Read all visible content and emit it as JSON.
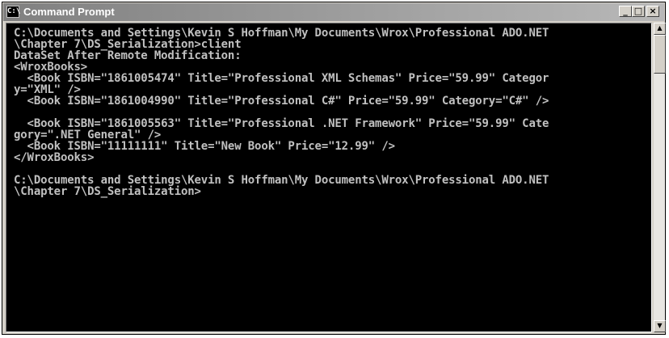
{
  "window": {
    "title": "Command Prompt",
    "icon_label": "C:\\",
    "buttons": {
      "minimize": "_",
      "maximize": "□",
      "close": "×"
    }
  },
  "console": {
    "lines": [
      "C:\\Documents and Settings\\Kevin S Hoffman\\My Documents\\Wrox\\Professional ADO.NET",
      "\\Chapter 7\\DS_Serialization>client",
      "DataSet After Remote Modification:",
      "<WroxBooks>",
      "  <Book ISBN=\"1861005474\" Title=\"Professional XML Schemas\" Price=\"59.99\" Categor",
      "y=\"XML\" />",
      "  <Book ISBN=\"1861004990\" Title=\"Professional C#\" Price=\"59.99\" Category=\"C#\" />",
      "",
      "  <Book ISBN=\"1861005563\" Title=\"Professional .NET Framework\" Price=\"59.99\" Cate",
      "gory=\".NET General\" />",
      "  <Book ISBN=\"11111111\" Title=\"New Book\" Price=\"12.99\" />",
      "</WroxBooks>",
      "",
      "C:\\Documents and Settings\\Kevin S Hoffman\\My Documents\\Wrox\\Professional ADO.NET",
      "\\Chapter 7\\DS_Serialization>"
    ]
  },
  "scrollbar": {
    "up_glyph": "▲",
    "down_glyph": "▼"
  }
}
